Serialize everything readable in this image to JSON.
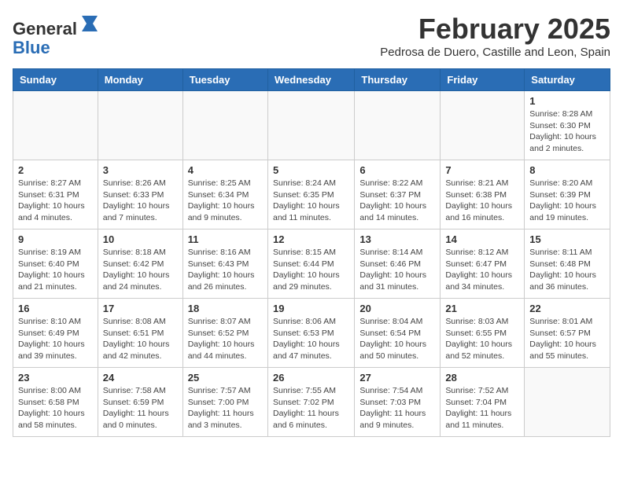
{
  "logo": {
    "general": "General",
    "blue": "Blue"
  },
  "header": {
    "title": "February 2025",
    "subtitle": "Pedrosa de Duero, Castille and Leon, Spain"
  },
  "days_of_week": [
    "Sunday",
    "Monday",
    "Tuesday",
    "Wednesday",
    "Thursday",
    "Friday",
    "Saturday"
  ],
  "weeks": [
    [
      {
        "day": "",
        "info": ""
      },
      {
        "day": "",
        "info": ""
      },
      {
        "day": "",
        "info": ""
      },
      {
        "day": "",
        "info": ""
      },
      {
        "day": "",
        "info": ""
      },
      {
        "day": "",
        "info": ""
      },
      {
        "day": "1",
        "info": "Sunrise: 8:28 AM\nSunset: 6:30 PM\nDaylight: 10 hours and 2 minutes."
      }
    ],
    [
      {
        "day": "2",
        "info": "Sunrise: 8:27 AM\nSunset: 6:31 PM\nDaylight: 10 hours and 4 minutes."
      },
      {
        "day": "3",
        "info": "Sunrise: 8:26 AM\nSunset: 6:33 PM\nDaylight: 10 hours and 7 minutes."
      },
      {
        "day": "4",
        "info": "Sunrise: 8:25 AM\nSunset: 6:34 PM\nDaylight: 10 hours and 9 minutes."
      },
      {
        "day": "5",
        "info": "Sunrise: 8:24 AM\nSunset: 6:35 PM\nDaylight: 10 hours and 11 minutes."
      },
      {
        "day": "6",
        "info": "Sunrise: 8:22 AM\nSunset: 6:37 PM\nDaylight: 10 hours and 14 minutes."
      },
      {
        "day": "7",
        "info": "Sunrise: 8:21 AM\nSunset: 6:38 PM\nDaylight: 10 hours and 16 minutes."
      },
      {
        "day": "8",
        "info": "Sunrise: 8:20 AM\nSunset: 6:39 PM\nDaylight: 10 hours and 19 minutes."
      }
    ],
    [
      {
        "day": "9",
        "info": "Sunrise: 8:19 AM\nSunset: 6:40 PM\nDaylight: 10 hours and 21 minutes."
      },
      {
        "day": "10",
        "info": "Sunrise: 8:18 AM\nSunset: 6:42 PM\nDaylight: 10 hours and 24 minutes."
      },
      {
        "day": "11",
        "info": "Sunrise: 8:16 AM\nSunset: 6:43 PM\nDaylight: 10 hours and 26 minutes."
      },
      {
        "day": "12",
        "info": "Sunrise: 8:15 AM\nSunset: 6:44 PM\nDaylight: 10 hours and 29 minutes."
      },
      {
        "day": "13",
        "info": "Sunrise: 8:14 AM\nSunset: 6:46 PM\nDaylight: 10 hours and 31 minutes."
      },
      {
        "day": "14",
        "info": "Sunrise: 8:12 AM\nSunset: 6:47 PM\nDaylight: 10 hours and 34 minutes."
      },
      {
        "day": "15",
        "info": "Sunrise: 8:11 AM\nSunset: 6:48 PM\nDaylight: 10 hours and 36 minutes."
      }
    ],
    [
      {
        "day": "16",
        "info": "Sunrise: 8:10 AM\nSunset: 6:49 PM\nDaylight: 10 hours and 39 minutes."
      },
      {
        "day": "17",
        "info": "Sunrise: 8:08 AM\nSunset: 6:51 PM\nDaylight: 10 hours and 42 minutes."
      },
      {
        "day": "18",
        "info": "Sunrise: 8:07 AM\nSunset: 6:52 PM\nDaylight: 10 hours and 44 minutes."
      },
      {
        "day": "19",
        "info": "Sunrise: 8:06 AM\nSunset: 6:53 PM\nDaylight: 10 hours and 47 minutes."
      },
      {
        "day": "20",
        "info": "Sunrise: 8:04 AM\nSunset: 6:54 PM\nDaylight: 10 hours and 50 minutes."
      },
      {
        "day": "21",
        "info": "Sunrise: 8:03 AM\nSunset: 6:55 PM\nDaylight: 10 hours and 52 minutes."
      },
      {
        "day": "22",
        "info": "Sunrise: 8:01 AM\nSunset: 6:57 PM\nDaylight: 10 hours and 55 minutes."
      }
    ],
    [
      {
        "day": "23",
        "info": "Sunrise: 8:00 AM\nSunset: 6:58 PM\nDaylight: 10 hours and 58 minutes."
      },
      {
        "day": "24",
        "info": "Sunrise: 7:58 AM\nSunset: 6:59 PM\nDaylight: 11 hours and 0 minutes."
      },
      {
        "day": "25",
        "info": "Sunrise: 7:57 AM\nSunset: 7:00 PM\nDaylight: 11 hours and 3 minutes."
      },
      {
        "day": "26",
        "info": "Sunrise: 7:55 AM\nSunset: 7:02 PM\nDaylight: 11 hours and 6 minutes."
      },
      {
        "day": "27",
        "info": "Sunrise: 7:54 AM\nSunset: 7:03 PM\nDaylight: 11 hours and 9 minutes."
      },
      {
        "day": "28",
        "info": "Sunrise: 7:52 AM\nSunset: 7:04 PM\nDaylight: 11 hours and 11 minutes."
      },
      {
        "day": "",
        "info": ""
      }
    ]
  ]
}
